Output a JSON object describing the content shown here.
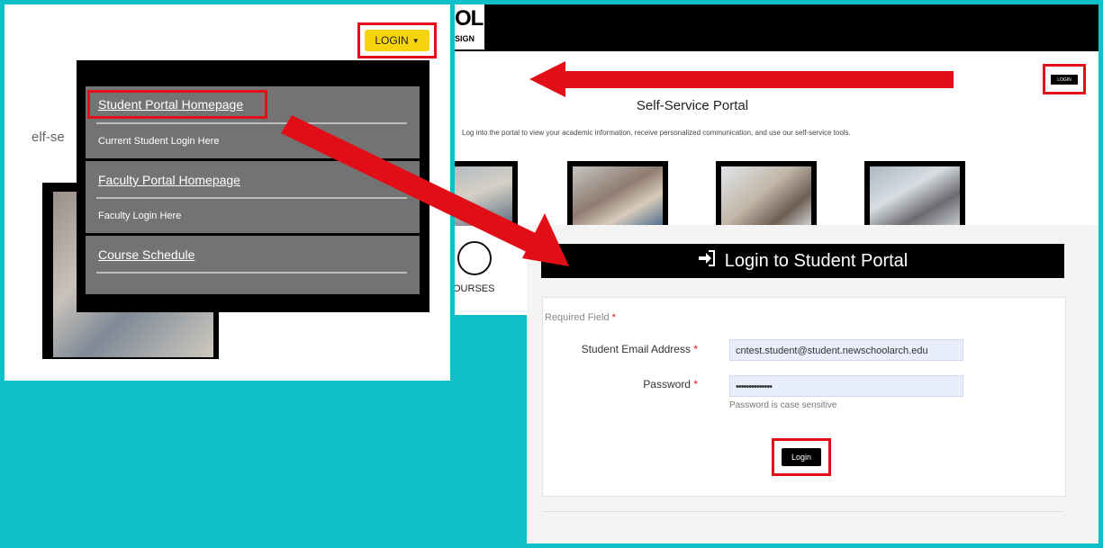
{
  "menu_panel": {
    "login_button": "LOGIN",
    "page_title_clipped": "elf-se",
    "items": [
      {
        "label": "Student Portal Homepage",
        "sub": "Current Student Login Here"
      },
      {
        "label": "Faculty Portal Homepage",
        "sub": "Faculty Login Here"
      },
      {
        "label": "Course Schedule",
        "sub": ""
      }
    ]
  },
  "portal_page": {
    "logo_top": "OL",
    "logo_bottom": "SIGN",
    "login_button": "LOGIN",
    "title": "Self-Service Portal",
    "description": "Log into the portal to view your academic information, receive personalized communication, and use our self-service tools.",
    "courses_label": "OURSES"
  },
  "login_form": {
    "header": "Login to Student Portal",
    "required_note": "Required Field",
    "email_label": "Student Email Address",
    "email_value": "cntest.student@student.newschoolarch.edu",
    "password_label": "Password",
    "password_value": "••••••••••••••",
    "password_hint": "Password is case sensitive",
    "login_button": "Login"
  },
  "colors": {
    "background": "#0fc0c8",
    "highlight": "#e20e17",
    "login_yellow": "#f5d40b",
    "menu_gray": "#737373"
  }
}
